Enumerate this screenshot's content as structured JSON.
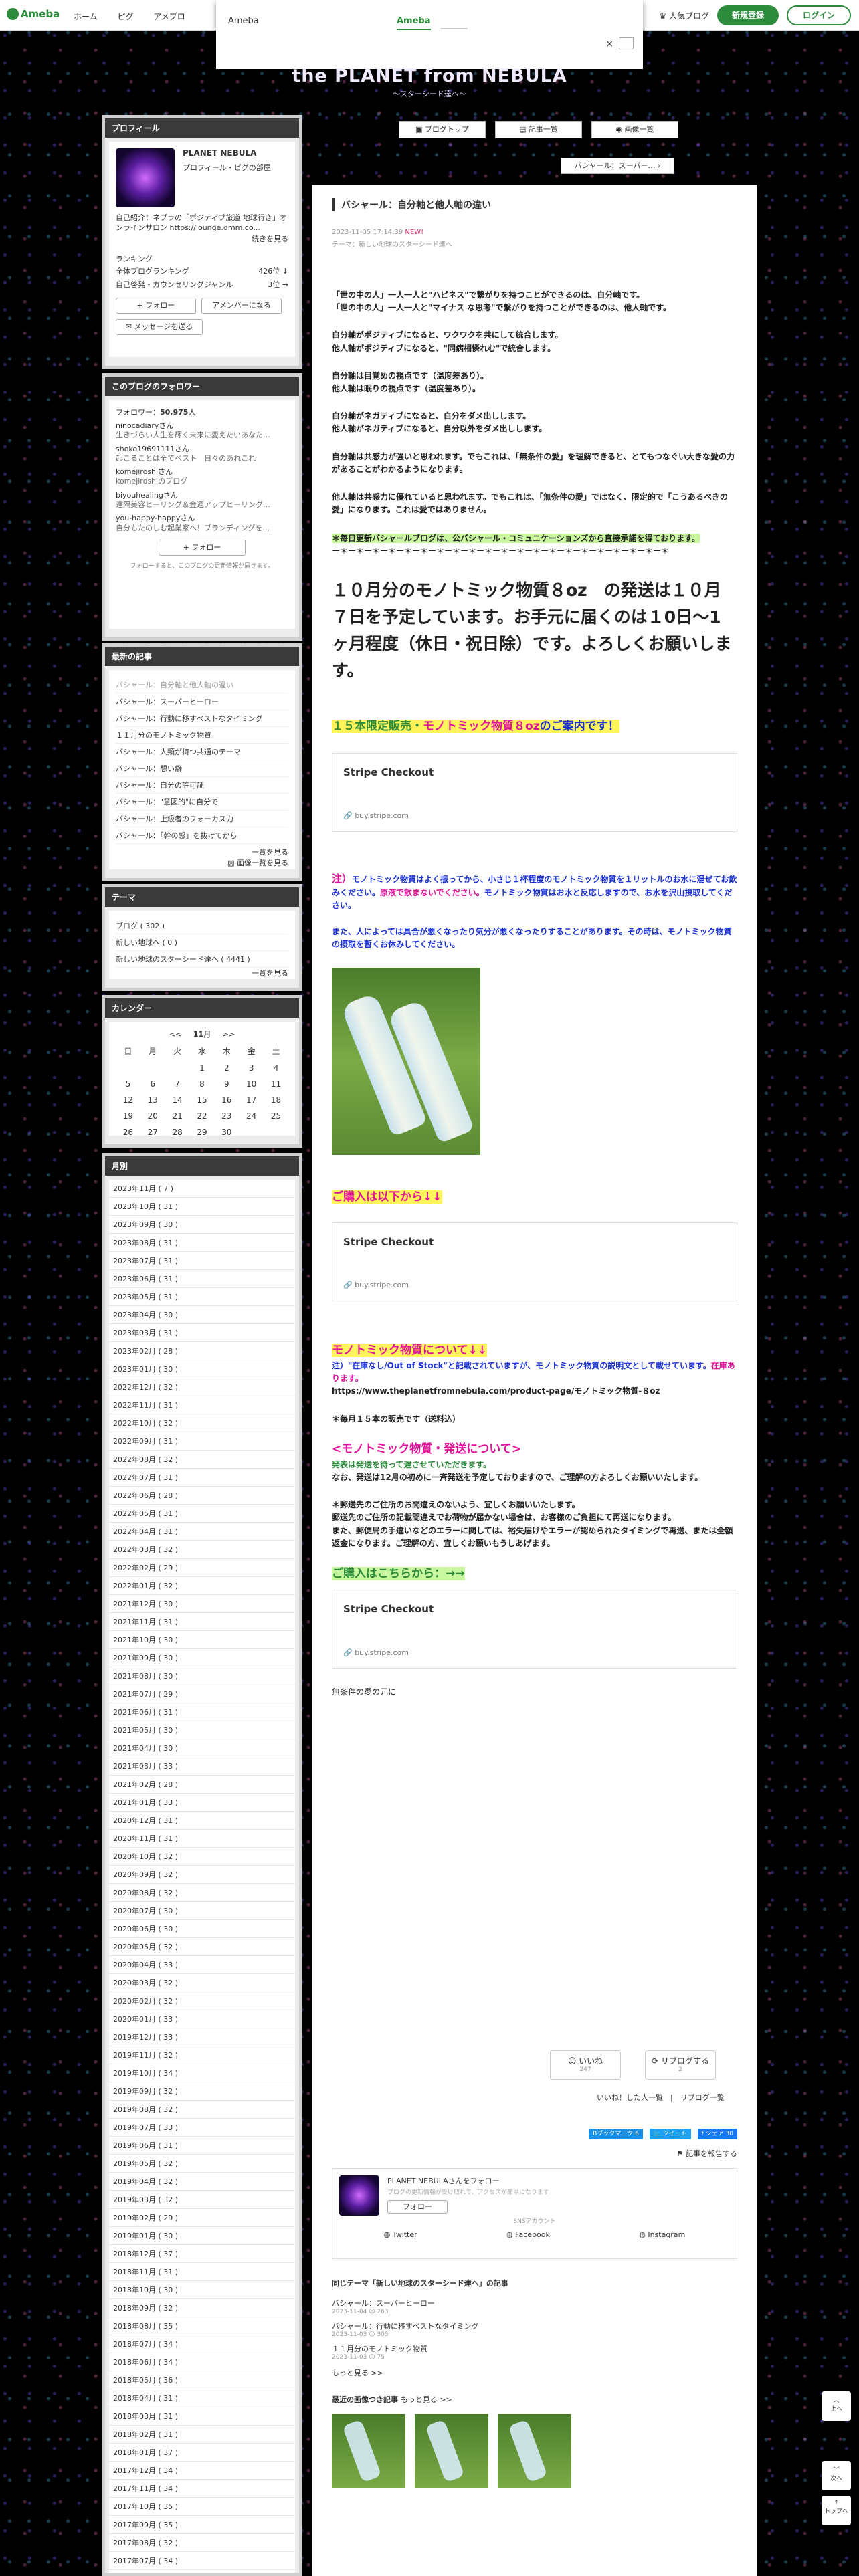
{
  "topbar": {
    "logo": "Ameba",
    "nav": [
      "ホーム",
      "ピグ",
      "アメブロ"
    ],
    "popular_blog": "人気ブログ",
    "signup": "新規登録",
    "login": "ログイン"
  },
  "popup": {
    "title": "Ameba",
    "tab": "Ameba",
    "close": "×"
  },
  "header": {
    "title": "the PLANET from NEBULA",
    "subtitle": "〜スターシード達へ〜",
    "nav": [
      "ブログトップ",
      "記事一覧",
      "画像一覧"
    ],
    "next_post": "バシャール：スーパー… ›"
  },
  "sidebar": {
    "profile": {
      "heading": "プロフィール",
      "name": "PLANET NEBULA",
      "sub": "プロフィール・ピグの部屋",
      "intro": "自己紹介：ネブラの「ポジティブ旅道 地球行き」オンラインサロン https://lounge.dmm.co...",
      "more": "続きを見る",
      "ranking_label": "ランキング",
      "rank1_label": "全体ブログランキング",
      "rank1_value": "426位 ↓",
      "rank2_label": "自己啓発・カウンセリングジャンル",
      "rank2_value": "3位 →",
      "follow_btn": "+ フォロー",
      "amember_btn": "アメンバーになる",
      "message_btn": "メッセージを送る"
    },
    "followers": {
      "heading": "このブログのフォロワー",
      "count_label": "フォロワー：",
      "count": "50,975",
      "count_suffix": "人",
      "items": [
        {
          "name": "ninocadiaryさん",
          "desc": "生きづらい人生を輝く未来に変えたいあなた…"
        },
        {
          "name": "shoko19691111さん",
          "desc": "起こることは全てベスト　日々のあれこれ"
        },
        {
          "name": "komejiroshiさん",
          "desc": "komejiroshiのブログ"
        },
        {
          "name": "biyouhealingさん",
          "desc": "遠隔美容ヒーリング＆金運アップヒーリング…"
        },
        {
          "name": "you-happy-happyさん",
          "desc": "自分もたのしむ起業家へ！ブランディングを…"
        }
      ],
      "follow_btn": "+ フォロー",
      "note": "フォローすると、このブログの更新情報が届きます。"
    },
    "recent": {
      "heading": "最新の記事",
      "items": [
        "バシャール：自分軸と他人軸の違い",
        "バシャール：スーパーヒーロー",
        "バシャール：行動に移すベストなタイミング",
        "１１月分のモノトミック物質",
        "バシャール：人類が持つ共通のテーマ",
        "バシャール：想い癖",
        "バシャール：自分の許可証",
        "バシャール：\"意図的\"に自分で",
        "バシャール：上級者のフォーカス力",
        "バシャール：「幹の感」を抜けてから"
      ],
      "more": "一覧を見る",
      "image_more": "画像一覧を見る"
    },
    "theme": {
      "heading": "テーマ",
      "items": [
        "ブログ ( 302 )",
        "新しい地球へ ( 0 )",
        "新しい地球のスターシード達へ ( 4441 )"
      ],
      "more": "一覧を見る"
    },
    "calendar": {
      "heading": "カレンダー",
      "prev": "<<",
      "month": "11月",
      "next": ">>",
      "weekdays": [
        "日",
        "月",
        "火",
        "水",
        "木",
        "金",
        "土"
      ],
      "weeks": [
        [
          "",
          "",
          "",
          "1",
          "2",
          "3",
          "4"
        ],
        [
          "5",
          "6",
          "7",
          "8",
          "9",
          "10",
          "11"
        ],
        [
          "12",
          "13",
          "14",
          "15",
          "16",
          "17",
          "18"
        ],
        [
          "19",
          "20",
          "21",
          "22",
          "23",
          "24",
          "25"
        ],
        [
          "26",
          "27",
          "28",
          "29",
          "30",
          "",
          ""
        ]
      ]
    },
    "archive": {
      "heading": "月別",
      "items": [
        "2023年11月 ( 7 )",
        "2023年10月 ( 31 )",
        "2023年09月 ( 30 )",
        "2023年08月 ( 31 )",
        "2023年07月 ( 31 )",
        "2023年06月 ( 31 )",
        "2023年05月 ( 31 )",
        "2023年04月 ( 30 )",
        "2023年03月 ( 31 )",
        "2023年02月 ( 28 )",
        "2023年01月 ( 30 )",
        "2022年12月 ( 32 )",
        "2022年11月 ( 31 )",
        "2022年10月 ( 32 )",
        "2022年09月 ( 31 )",
        "2022年08月 ( 32 )",
        "2022年07月 ( 31 )",
        "2022年06月 ( 28 )",
        "2022年05月 ( 31 )",
        "2022年04月 ( 31 )",
        "2022年03月 ( 32 )",
        "2022年02月 ( 29 )",
        "2022年01月 ( 32 )",
        "2021年12月 ( 30 )",
        "2021年11月 ( 31 )",
        "2021年10月 ( 30 )",
        "2021年09月 ( 30 )",
        "2021年08月 ( 30 )",
        "2021年07月 ( 29 )",
        "2021年06月 ( 31 )",
        "2021年05月 ( 30 )",
        "2021年04月 ( 30 )",
        "2021年03月 ( 33 )",
        "2021年02月 ( 28 )",
        "2021年01月 ( 33 )",
        "2020年12月 ( 31 )",
        "2020年11月 ( 31 )",
        "2020年10月 ( 32 )",
        "2020年09月 ( 32 )",
        "2020年08月 ( 32 )",
        "2020年07月 ( 30 )",
        "2020年06月 ( 30 )",
        "2020年05月 ( 32 )",
        "2020年04月 ( 33 )",
        "2020年03月 ( 32 )",
        "2020年02月 ( 32 )",
        "2020年01月 ( 33 )",
        "2019年12月 ( 33 )",
        "2019年11月 ( 32 )",
        "2019年10月 ( 34 )",
        "2019年09月 ( 32 )",
        "2019年08月 ( 32 )",
        "2019年07月 ( 33 )",
        "2019年06月 ( 31 )",
        "2019年05月 ( 32 )",
        "2019年04月 ( 32 )",
        "2019年03月 ( 32 )",
        "2019年02月 ( 29 )",
        "2019年01月 ( 30 )",
        "2018年12月 ( 37 )",
        "2018年11月 ( 31 )",
        "2018年10月 ( 30 )",
        "2018年09月 ( 32 )",
        "2018年08月 ( 35 )",
        "2018年07月 ( 34 )",
        "2018年06月 ( 34 )",
        "2018年05月 ( 36 )",
        "2018年04月 ( 31 )",
        "2018年03月 ( 31 )",
        "2018年02月 ( 31 )",
        "2018年01月 ( 37 )",
        "2017年12月 ( 34 )",
        "2017年11月 ( 34 )",
        "2017年10月 ( 35 )",
        "2017年09月 ( 35 )",
        "2017年08月 ( 32 )",
        "2017年07月 ( 34 )",
        "2017年06月 ( 32 )",
        "2017年05月 ( 34 )",
        "2017年04月 ( 32 )",
        "2017年03月 ( 33 )",
        "2017年02月 ( 31 )",
        "2017年01月 ( 32 )",
        "2016年12月 ( 35 )"
      ]
    }
  },
  "post": {
    "title": "バシャール：自分軸と他人軸の違い",
    "date": "2023-11-05 17:14:39",
    "new_badge": "NEW!",
    "theme": "テーマ：新しい地球のスターシード達へ",
    "paragraphs": [
      [
        "「世の中の人」一人一人と\"ハピネス\"で繋がりを持つことができるのは、自分軸です。",
        "「世の中の人」一人一人と\"マイナス な思考\"で繋がりを持つことができるのは、他人軸です。"
      ],
      [
        "自分軸がポジティブになると、ワクワクを共にして統合します。",
        "他人軸がポジティブになると、\"同病相憐れむ\"で統合します。"
      ],
      [
        "自分軸は目覚めの視点です（温度差あり）。",
        "他人軸は眠りの視点です（温度差あり）。"
      ],
      [
        "自分軸がネガティブになると、自分をダメ出しします。",
        "他人軸がネガティブになると、自分以外をダメ出しします。"
      ],
      [
        "自分軸は共感力が強いと思われます。でもこれは、「無条件の愛」を理解できると、とてもつなぐい大きな愛の力があることがわかるようになります。"
      ],
      [
        "他人軸は共感力に優れていると思われます。でもこれは、「無条件の愛」ではなく、限定的で「こうあるべきの愛」になります。これは愛ではありません。"
      ]
    ],
    "notice": "＊毎日更新バシャールブログは、公バシャール・コミュニケーションズから直接承諾を得ております。",
    "divider": "ー＊ー＊ー＊ー＊ー＊ー＊ー＊ー＊ー＊ー＊ー＊ー＊ー＊ー＊ー＊ー＊ー＊ー＊ー＊ー＊ー＊",
    "big_notice": "１０月分のモノトミック物質８oz　の発送は１０月７日を予定しています。お手元に届くのは１0日〜1ヶ月程度（休日・祝日除）です。よろしくお願いします。",
    "limited_a": "１５本限定販売・",
    "limited_b": "モノトミック物質８oz",
    "limited_c": "のご案内です！",
    "stripe_title": "Stripe Checkout",
    "stripe_url": "buy.stripe.com",
    "note1_a": "注）",
    "note1_b": "モノトミック物質はよく振ってから、小さじ１杯程度のモノトミック物質を１リットルのお水に混ぜてお飲みください。",
    "note1_c": "原液で飲まないでください。",
    "note1_d": "モノトミック物質はお水と反応しますので、お水を沢山摂取してください。",
    "note2": "また、人によっては具合が悪くなったり気分が悪くなったりすることがあります。その時は、モノトミック物質の摂取を暫くお休みしてください。",
    "purchase1": "ご購入は以下から↓↓",
    "about_heading": "モノトミック物質について↓↓",
    "about_note_a": "注）\"在庫なし/Out of Stock\"と記載されていますが、モノトミック物質の説明文として載せています。",
    "about_note_b": "在庫あります。",
    "about_url": "https://www.theplanetfromnebula.com/product-page/モノトミック物質-８oz",
    "monthly": "＊毎月１５本の販売です（送料込）",
    "shipping_heading": "<モノトミック物質・発送について>",
    "shipping_1": "発表は発送を待って遅させていただきます。",
    "shipping_2": "なお、発送は12月の初めに一斉発送を予定しておりますので、ご理解の方よろしくお願いいたします。",
    "shipping_3": "＊郵送先のご住所のお間違えのないよう、宜しくお願いいたします。",
    "shipping_4": "郵送先のご住所の記載間違えでお荷物が届かない場合は、お客様のご負担にて再送になります。",
    "shipping_5": "また、郵便局の手違いなどのエラーに関しては、裕失届けやエラーが認められたタイミングで再送、または全額返金になります。ご理解の方、宜しくお願いもうしあげます。",
    "purchase2": "ご購入はこちらから：→→",
    "closing": "無条件の愛の元に",
    "like_label": "いいね",
    "like_count": "247",
    "reblog_label": "リブログする",
    "reblog_count": "2",
    "like_links": "いいね！した人一覧　|　リブログ一覧",
    "bookmark": "Bブックマーク",
    "bookmark_count": "6",
    "tweet": "ツイート",
    "share": "シェア",
    "share_count": "30",
    "report": "記事を報告する",
    "follow_author": "PLANET NEBULAさんをフォロー",
    "follow_desc": "ブログの更新情報が受け取れて、アクセスが簡単になります",
    "follow_btn": "フォロー",
    "sns_label": "SNSアカウント",
    "sns": [
      "Twitter",
      "Facebook",
      "Instagram"
    ],
    "same_theme_heading": "同じテーマ「新しい地球のスターシード達へ」の記事",
    "same_theme": [
      {
        "title": "バシャール：スーパーヒーロー",
        "date": "2023-11-04",
        "count": "263"
      },
      {
        "title": "バシャール：行動に移すベストなタイミング",
        "date": "2023-11-03",
        "count": "305"
      },
      {
        "title": "１１月分のモノトミック物質",
        "date": "2023-11-03",
        "count": "75"
      }
    ],
    "more": "もっと見る >>",
    "recent_images": "最近の画像つき記事",
    "recent_images_more": "もっと見る >>",
    "side_up": "ページの先頭へ",
    "side_up2": "上へ",
    "side_next": "次へ",
    "side_top": "トップへ"
  }
}
